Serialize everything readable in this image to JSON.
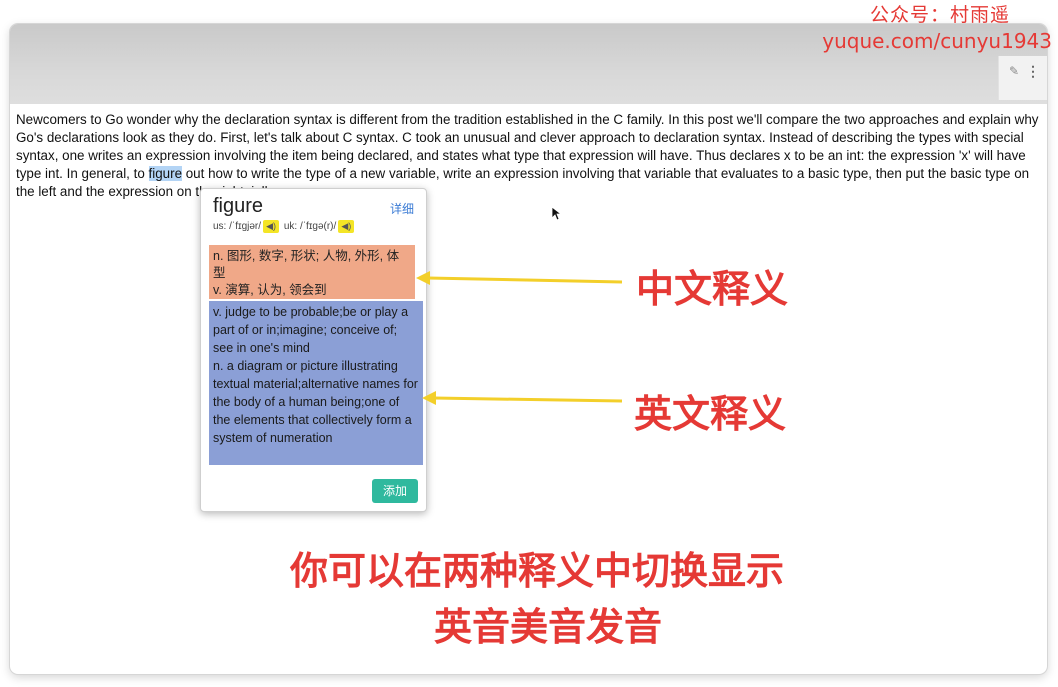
{
  "watermark": {
    "line1": "公众号：村雨遥",
    "line2": "yuque.com/cunyu1943"
  },
  "toolbar": {
    "pin_icon": "pin-icon",
    "more_icon": "more-vertical-icon",
    "more_glyph": "⋮"
  },
  "article": {
    "before": "Newcomers to Go wonder why the declaration syntax is different from the tradition established in the C family. In this post we'll compare the two approaches and explain why Go's declarations look as they do. First, let's talk about C syntax. C took an unusual and clever approach to declaration syntax. Instead of describing the types with special syntax, one writes an expression involving the item being declared, and states what type that expression will have. Thus declares x to be an int: the expression 'x' will have type int. In general, to ",
    "selected": "figure",
    "after": " out how to write the type of a new variable, write an expression involving that variable that evaluates to a basic type, then put the basic type on the left and the expression on the right. ielly"
  },
  "popup": {
    "word": "figure",
    "detail_link": "详细",
    "us_label": "us:",
    "us_phonetic": "/ˈfɪɡjər/",
    "uk_label": "uk:",
    "uk_phonetic": "/ˈfɪɡə(r)/",
    "cn_definitions": [
      "n. 图形, 数字, 形状; 人物, 外形, 体型",
      "v. 演算, 认为, 领会到"
    ],
    "en_definitions": [
      "v. judge to be probable;be or play a part of or in;imagine; conceive of; see in one's mind",
      "n. a diagram or picture illustrating textual material;alternative names for the body of a human being;one of the elements that collectively form a system of numeration"
    ],
    "add_button": "添加"
  },
  "annotations": {
    "cn_label": "中文释义",
    "en_label": "英文释义",
    "switch_text": "你可以在两种释义中切换显示",
    "pronounce_text": "英音美音发音",
    "color": "#e53935",
    "arrow_color": "#f3cf2a"
  }
}
